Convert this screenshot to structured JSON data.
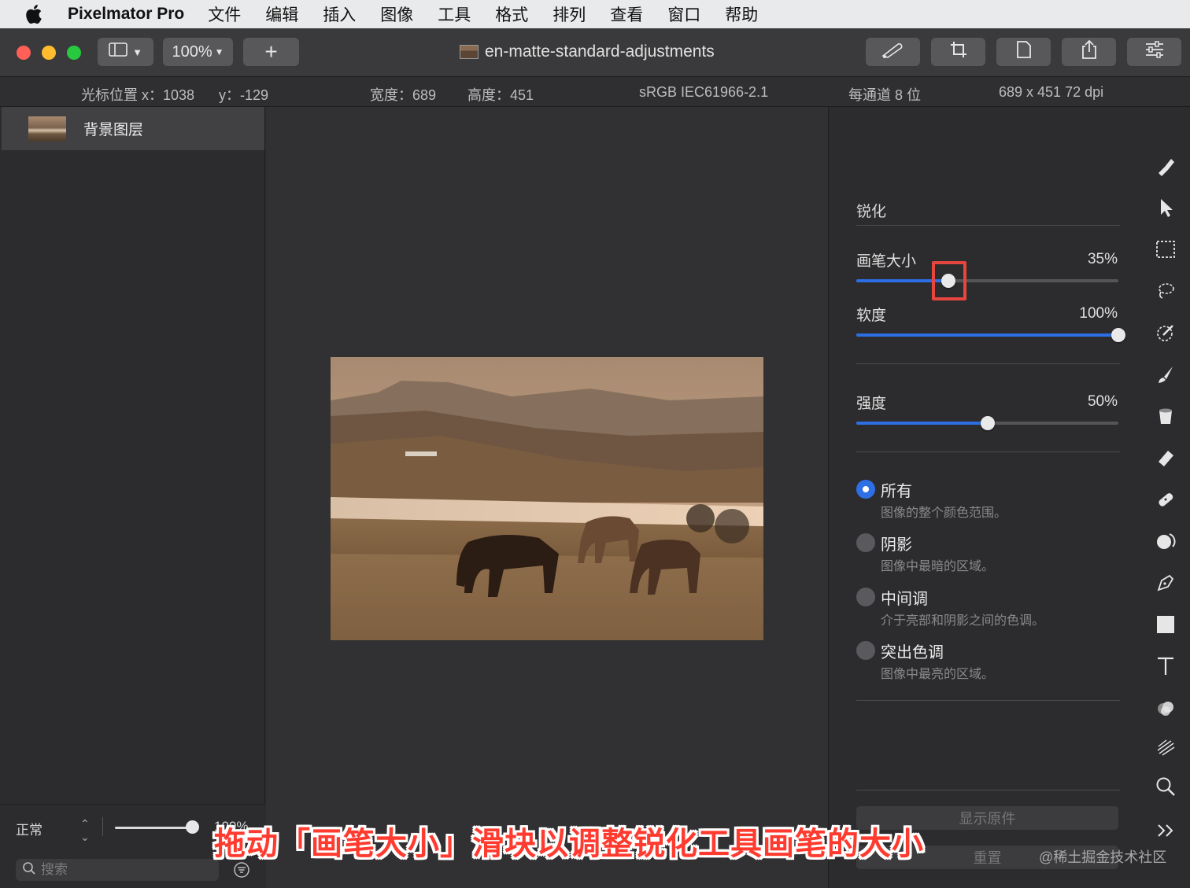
{
  "menubar": {
    "app_name": "Pixelmator Pro",
    "items": [
      "文件",
      "编辑",
      "插入",
      "图像",
      "工具",
      "格式",
      "排列",
      "查看",
      "窗口",
      "帮助"
    ]
  },
  "toolbar": {
    "zoom": "100%",
    "add_label": "+",
    "document_title": "en-matte-standard-adjustments"
  },
  "infobar": {
    "cursor_x": "光标位置 x：1038",
    "cursor_y": "y：-129",
    "width": "宽度：689",
    "height": "高度：451",
    "color_profile": "sRGB IEC61966-2.1",
    "bit_depth": "每通道 8 位",
    "dimensions": "689 x 451 72 dpi"
  },
  "layers": {
    "items": [
      {
        "name": "背景图层"
      }
    ],
    "blend_mode": "正常",
    "opacity_text": "100%",
    "search_placeholder": "搜索"
  },
  "adjust": {
    "section_title": "锐化",
    "sliders": [
      {
        "label": "画笔大小",
        "value_text": "35%",
        "fraction": 0.35
      },
      {
        "label": "软度",
        "value_text": "100%",
        "fraction": 1.0
      },
      {
        "label": "强度",
        "value_text": "50%",
        "fraction": 0.5
      }
    ],
    "ranges": [
      {
        "title": "所有",
        "desc": "图像的整个颜色范围。",
        "selected": true
      },
      {
        "title": "阴影",
        "desc": "图像中最暗的区域。",
        "selected": false
      },
      {
        "title": "中间调",
        "desc": "介于亮部和阴影之间的色调。",
        "selected": false
      },
      {
        "title": "突出色调",
        "desc": "图像中最亮的区域。",
        "selected": false
      }
    ],
    "show_original": "显示原件",
    "reset": "重置"
  },
  "tools": [
    "paint-style-icon",
    "arrange-icon",
    "rectangular-select-icon",
    "lasso-icon",
    "color-adjust-icon",
    "paint-brush-icon",
    "paint-bucket-icon",
    "eraser-icon",
    "repair-icon",
    "distort-icon",
    "pen-icon",
    "shape-icon",
    "type-icon",
    "effects-icon",
    "sharpen-icon",
    "zoom-icon",
    "more-tools-icon"
  ],
  "colors": {
    "accent": "#2e6ee4",
    "annotation": "#ff3b30"
  },
  "annotation": {
    "caption": "拖动「画笔大小」滑块以调整锐化工具画笔的大小",
    "watermark": "@稀土掘金技术社区"
  }
}
